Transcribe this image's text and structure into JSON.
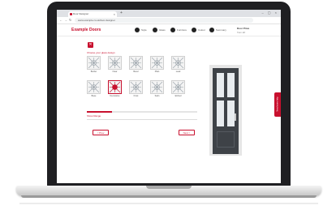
{
  "browser": {
    "tab_title": "Door Designer",
    "url": "www.example.co.uk/door-designer"
  },
  "site": {
    "logo": "Example Doors",
    "steps": [
      "Style",
      "Glass",
      "Furniture",
      "Colour",
      "Summary"
    ],
    "price_label": "Door Price",
    "price_sub": "from £0"
  },
  "designer": {
    "panel_title": "Choose your glass design",
    "glass_options": [
      {
        "label": "Border",
        "icon": "glass-pattern",
        "selected": false
      },
      {
        "label": "Clear",
        "icon": "glass-pattern",
        "selected": false
      },
      {
        "label": "Bevel",
        "icon": "glass-pattern",
        "selected": false
      },
      {
        "label": "Plain",
        "icon": "glass-pattern",
        "selected": false
      },
      {
        "label": "Lead",
        "icon": "glass-pattern",
        "selected": false
      },
      {
        "label": "Base",
        "icon": "glass-pattern",
        "selected": false
      },
      {
        "label": "Decorative",
        "icon": "glass-pattern-red",
        "selected": true
      },
      {
        "label": "Frost",
        "icon": "glass-pattern",
        "selected": false
      },
      {
        "label": "Satin",
        "icon": "glass-pattern",
        "selected": false
      },
      {
        "label": "Etched",
        "icon": "glass-pattern",
        "selected": false
      }
    ],
    "progress": 0.23,
    "more_label": "Show Range",
    "prev_label": "< Prev",
    "next_label": "Next >"
  },
  "help_tab": "Need some help",
  "colors": {
    "accent": "#c8102e",
    "door": "#3e4247",
    "laptop_bezel": "#1f1f22"
  }
}
